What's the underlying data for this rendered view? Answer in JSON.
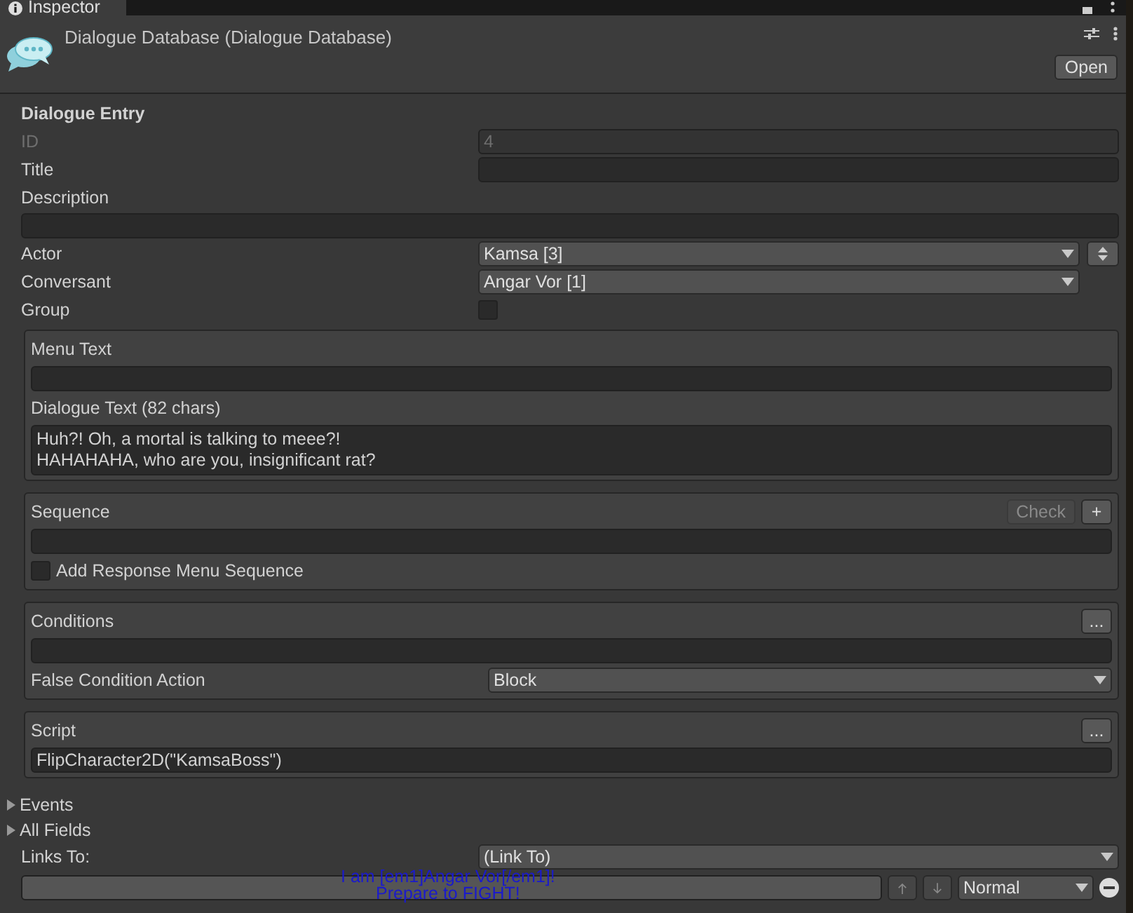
{
  "tab": {
    "title": "Inspector"
  },
  "header": {
    "title": "Dialogue Database (Dialogue Database)",
    "open_button": "Open"
  },
  "section_title": "Dialogue Entry",
  "fields": [
    {
      "kind": "text",
      "label": "ID",
      "value": "4",
      "disabled": true
    },
    {
      "kind": "text",
      "label": "Title",
      "disabled": false
    },
    {
      "kind": "wide",
      "label": "Description"
    },
    {
      "kind": "dropdown_swap",
      "label": "Actor",
      "value": "Kamsa [3]"
    },
    {
      "kind": "dropdown",
      "label": "Conversant",
      "value": "Angar Vor [1]"
    },
    {
      "kind": "checkbox",
      "label": "Group",
      "checked": false
    }
  ],
  "menu_box": {
    "menu_label": "Menu Text",
    "dialogue_label": "Dialogue Text (82 chars)",
    "dialogue_lines": [
      "Huh?! Oh, a mortal is talking to meee?!",
      "HAHAHAHA, who are you, insignificant rat?"
    ]
  },
  "sequence_box": {
    "label": "Sequence",
    "check_button": "Check",
    "add_button": "+",
    "option": {
      "label": "Add Response Menu Sequence",
      "checked": false
    }
  },
  "conditions_box": {
    "label": "Conditions",
    "more_button": "...",
    "false_action_label": "False Condition Action",
    "false_action_value": "Block"
  },
  "script_box": {
    "label": "Script",
    "more_button": "...",
    "value": "FlipCharacter2D(\"KamsaBoss\")"
  },
  "foldouts": [
    {
      "label": "Events",
      "expanded": false
    },
    {
      "label": "All Fields",
      "expanded": false
    }
  ],
  "links": {
    "label": "Links To:",
    "dropdown": "(Link To)",
    "rows": [
      {
        "overlay_lines": [
          "I am [em1]Angar Vor[/em1]!",
          "Prepare to FIGHT!"
        ],
        "priority": "Normal"
      }
    ]
  }
}
